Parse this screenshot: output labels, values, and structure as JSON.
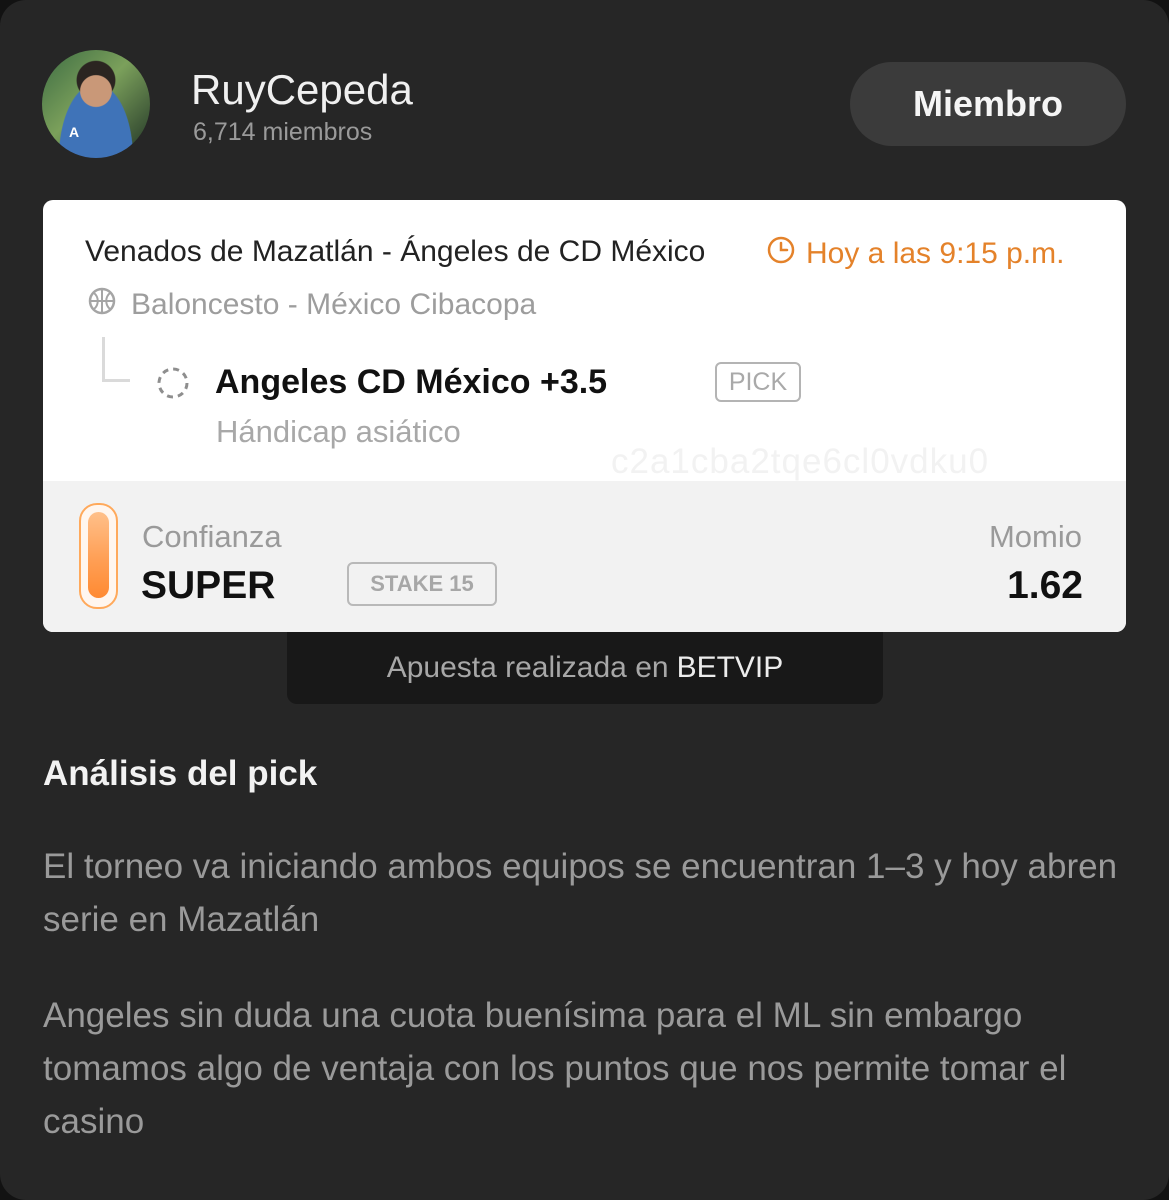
{
  "header": {
    "avatar_icon": "profile-photo",
    "username": "RuyCepeda",
    "members": "6,714 miembros",
    "button_label": "Miembro"
  },
  "bet_card": {
    "match": "Venados de Mazatlán  - Ángeles de CD México",
    "time": "Hoy a las 9:15 p.m.",
    "time_icon": "clock-icon",
    "sport_icon": "basketball-icon",
    "league": "Baloncesto - México Cibacopa",
    "status_icon": "pending-circle-icon",
    "pick": "Angeles CD México +3.5",
    "pick_badge": "PICK",
    "market": "Hándicap asiático",
    "watermark": "c2a1cba2tqe6cl0vdku0",
    "confidence_label": "Confianza",
    "confidence_value": "SUPER",
    "stake": "STAKE 15",
    "odds_label": "Momio",
    "odds_value": "1.62",
    "accent_color": "#ff8a32"
  },
  "bookmaker": {
    "prefix": "Apuesta realizada en",
    "name": "BETVIP"
  },
  "analysis": {
    "title": "Análisis del pick",
    "paragraphs": [
      "El torneo va iniciando ambos equipos se encuentran 1–3 y hoy abren serie en Mazatlán",
      "Angeles sin duda una cuota buenísima para el ML sin embargo tomamos algo de ventaja con los puntos que nos permite tomar el casino"
    ]
  }
}
